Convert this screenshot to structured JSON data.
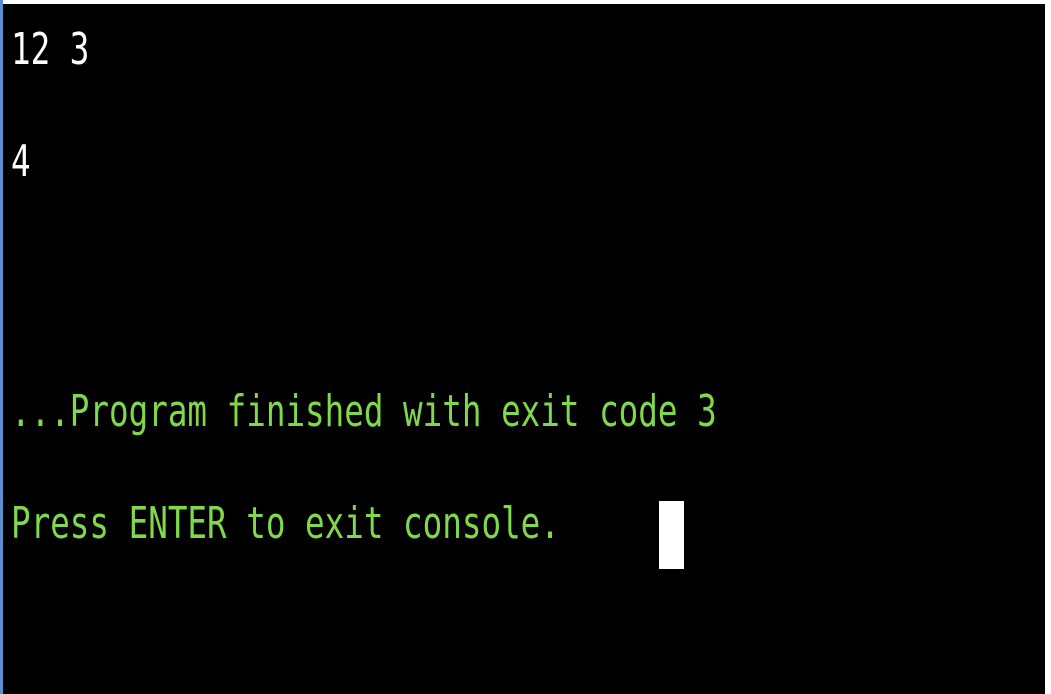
{
  "console": {
    "output_lines": [
      "12 3",
      "4"
    ],
    "status_line": "...Program finished with exit code 3",
    "prompt_line": "Press ENTER to exit console."
  },
  "colors": {
    "background": "#000000",
    "output_text": "#ffffff",
    "status_text": "#7fd94a",
    "cursor": "#ffffff"
  }
}
